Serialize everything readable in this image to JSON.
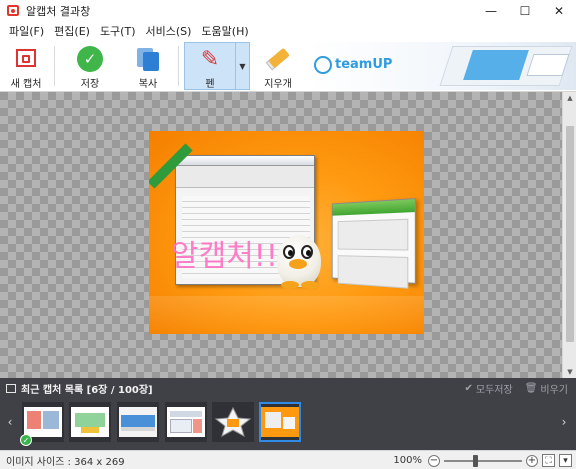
{
  "window": {
    "title": "알캡처 결과창",
    "controls": {
      "minimize": "—",
      "maximize": "☐",
      "close": "✕"
    }
  },
  "menu": [
    {
      "label": "파일(F)"
    },
    {
      "label": "편집(E)"
    },
    {
      "label": "도구(T)"
    },
    {
      "label": "서비스(S)"
    },
    {
      "label": "도움말(H)"
    }
  ],
  "toolbar": {
    "new_capture": "새 캡처",
    "save": "저장",
    "copy": "복사",
    "pen": "펜",
    "eraser": "지우개",
    "pen_active": true
  },
  "banner": {
    "brand": "teamUP"
  },
  "capture_image": {
    "handwriting": "알캡처!!",
    "handwriting_color": "#ff6fc2",
    "background_color": "#ff9a10"
  },
  "thumbnails_panel": {
    "title": "최근 캡처 목록 [6장 / 100장]",
    "save_all": "모두저장",
    "clear": "비우기",
    "prev_arrow": "‹",
    "next_arrow": "›",
    "thumbnails": [
      {
        "name": "thumb-1",
        "has_check": true
      },
      {
        "name": "thumb-2",
        "has_check": false
      },
      {
        "name": "thumb-3",
        "has_check": false
      },
      {
        "name": "thumb-4",
        "has_check": false
      },
      {
        "name": "thumb-5",
        "has_check": false
      },
      {
        "name": "thumb-6",
        "has_check": false,
        "selected": true
      }
    ]
  },
  "status": {
    "image_size": "이미지 사이즈 : 364 x 269",
    "zoom": "100%",
    "zoom_level": 100
  },
  "colors": {
    "accent": "#2f8be6",
    "panel_bg": "#3f4147",
    "toolbar_active": "#cde3f7"
  }
}
